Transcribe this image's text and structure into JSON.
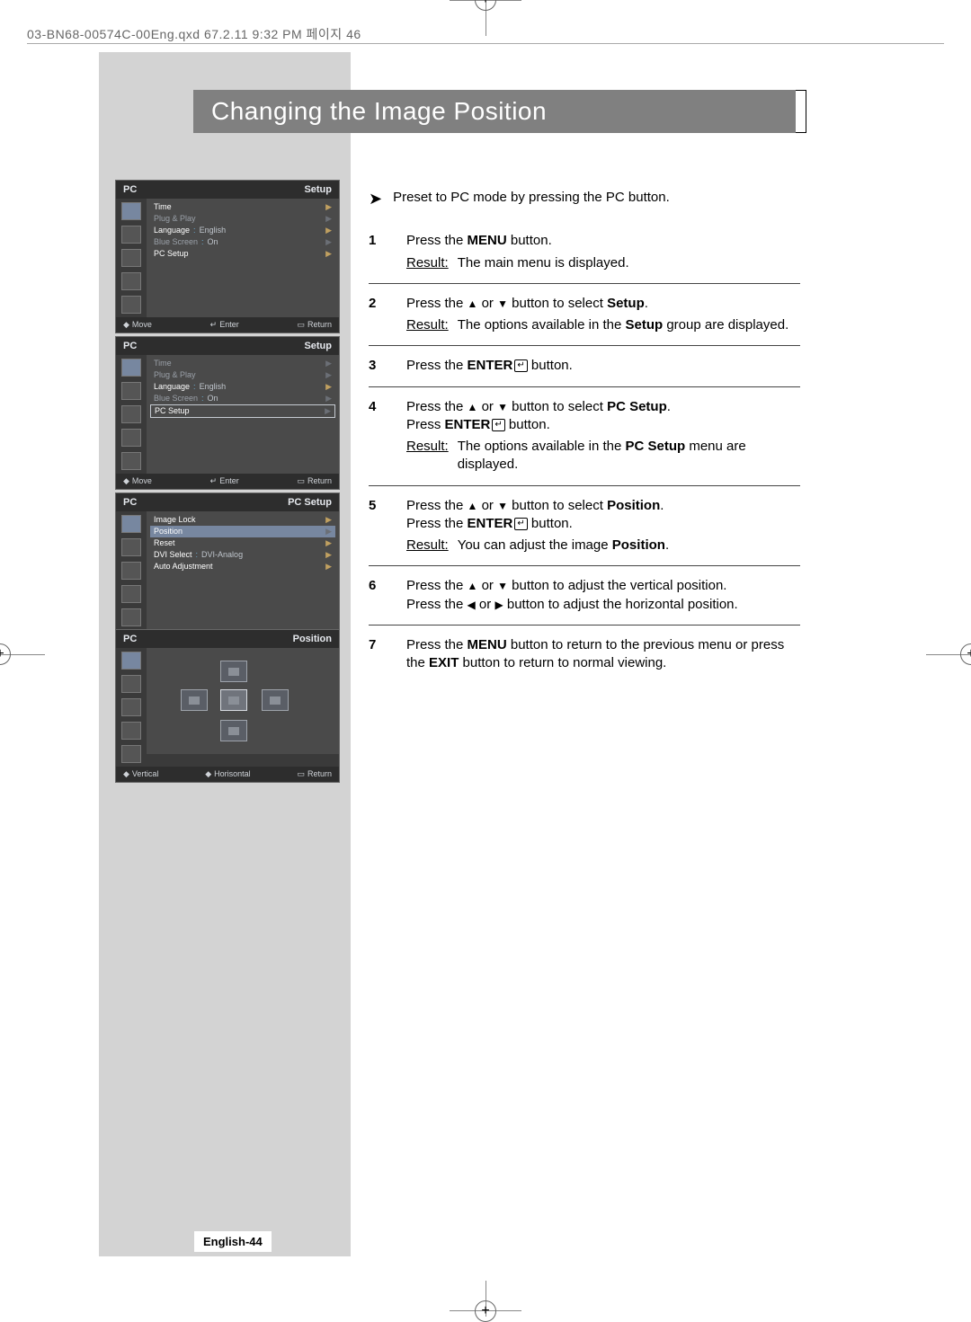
{
  "header_line": "03-BN68-00574C-00Eng.qxd  67.2.11 9:32 PM  페이지 46",
  "title": "Changing the Image Position",
  "page_label": "English-44",
  "preline": "Preset to PC mode by pressing the PC button.",
  "steps": {
    "s1": {
      "num": "1",
      "text_a": "Press the ",
      "text_b": "MENU",
      "text_c": " button.",
      "result": "The main menu is displayed."
    },
    "s2": {
      "num": "2",
      "text_a": "Press the ",
      "text_b": " button to select ",
      "text_c": "Setup",
      "result_a": "The options available in the ",
      "result_b": "Setup",
      "result_c": " group are displayed."
    },
    "s3": {
      "num": "3",
      "text_a": "Press the ",
      "text_b": "ENTER",
      "text_c": " button."
    },
    "s4": {
      "num": "4",
      "text_a": "Press the ",
      "text_b": " button to select ",
      "text_c": "PC Setup",
      "line2_a": "Press ",
      "line2_b": "ENTER",
      "line2_c": " button.",
      "result_a": "The options available in the ",
      "result_b": "PC Setup",
      "result_c": " menu are displayed."
    },
    "s5": {
      "num": "5",
      "text_a": "Press the ",
      "text_b": " button to select ",
      "text_c": "Position",
      "line2_a": "Press the ",
      "line2_b": "ENTER",
      "line2_c": " button.",
      "result_a": "You can adjust the image ",
      "result_b": "Position",
      "result_c": "."
    },
    "s6": {
      "num": "6",
      "line1_a": "Press the ",
      "line1_b": " button to adjust the vertical position.",
      "line2_a": "Press the ",
      "line2_b": " button to adjust the horizontal position."
    },
    "s7": {
      "num": "7",
      "text_a": "Press the ",
      "text_b": "MENU",
      "text_c": " button to return to the previous menu or press the ",
      "text_d": "EXIT",
      "text_e": " button to return to normal viewing."
    }
  },
  "result_label": "Result:",
  "osd": {
    "pc_label": "PC",
    "setup_label": "Setup",
    "pcsetup_label": "PC Setup",
    "position_label": "Position",
    "footer_move": "Move",
    "footer_enter": "Enter",
    "footer_return": "Return",
    "footer_vertical": "Vertical",
    "footer_horizontal": "Horisontal",
    "menu1": {
      "time": "Time",
      "plugplay": "Plug & Play",
      "language": "Language",
      "language_val": "English",
      "bluescreen": "Blue Screen",
      "bluescreen_val": "On",
      "pcsetup": "PC Setup"
    },
    "menu3": {
      "imagelock": "Image Lock",
      "position": "Position",
      "reset": "Reset",
      "dviselect": "DVI Select",
      "dviselect_val": "DVI-Analog",
      "autoadj": "Auto Adjustment"
    }
  }
}
